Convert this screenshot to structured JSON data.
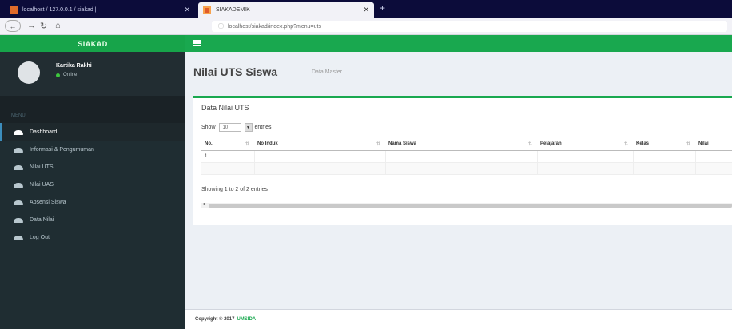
{
  "browser": {
    "tabs": [
      {
        "title": "localhost / 127.0.0.1 / siakad |",
        "close": "✕"
      },
      {
        "title": "SIAKADEMIK",
        "close": "✕"
      }
    ],
    "new_tab": "+",
    "url": "localhost/siakad/index.php?menu=uts"
  },
  "app": {
    "brand": "SIAKAD",
    "accent": "#19a84f",
    "sidebar_bg": "#1f2d32"
  },
  "user": {
    "name": "Kartika Rakhi",
    "status": "Online"
  },
  "sidebar": {
    "header": "MENU",
    "items": [
      {
        "label": "Dashboard",
        "icon": "dashboard-icon"
      },
      {
        "label": "Informasi & Pengumuman",
        "icon": "info-icon"
      },
      {
        "label": "Nilai UTS",
        "icon": "grade-icon"
      },
      {
        "label": "Nilai UAS",
        "icon": "grade-icon"
      },
      {
        "label": "Absensi Siswa",
        "icon": "attendance-icon"
      },
      {
        "label": "Data Nilai",
        "icon": "data-icon"
      },
      {
        "label": "Log Out",
        "icon": "logout-icon"
      }
    ]
  },
  "page": {
    "title": "Nilai UTS Siswa",
    "subtitle": "Data Master"
  },
  "box": {
    "title": "Data Nilai UTS",
    "show_label": "Show",
    "show_value": "10",
    "entries_label": "entries",
    "columns": [
      "No.",
      "No Induk",
      "Nama Siswa",
      "Pelajaran",
      "Kelas",
      "Nilai"
    ],
    "rows": [
      [
        "1",
        "",
        "",
        "",
        "",
        ""
      ],
      [
        "",
        "",
        "",
        "",
        "",
        ""
      ]
    ],
    "info": "Showing 1 to 2 of 2 entries"
  },
  "footer": {
    "text": "Copyright © 2017",
    "brand": "UMSIDA"
  }
}
